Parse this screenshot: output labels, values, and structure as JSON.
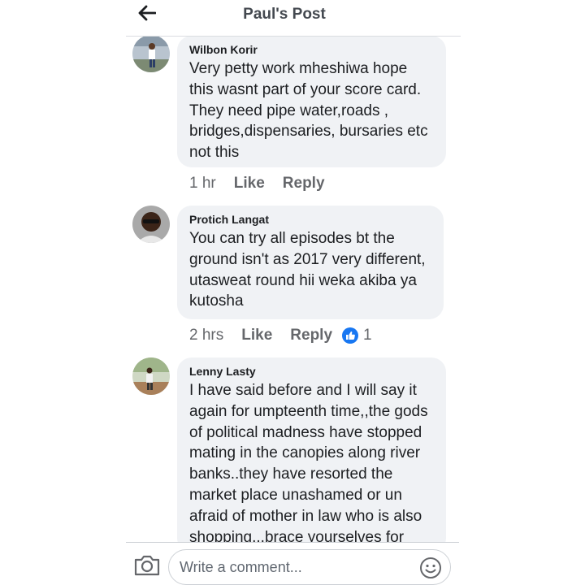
{
  "header": {
    "title": "Paul's Post",
    "back_icon": "arrow-left-icon"
  },
  "comments": [
    {
      "author": "Wilbon Korir",
      "lines": [
        "Very petty work mheshiwa hope",
        "this wasnt part of your score card.",
        "They need pipe water,roads ,",
        "bridges,dispensaries, bursaries etc",
        "not this"
      ],
      "time": "1 hr",
      "like": "Like",
      "reply": "Reply"
    },
    {
      "author": "Protich Langat",
      "lines": [
        "You can try all episodes bt the",
        "ground isn't as 2017 very different,",
        "utasweat round hii weka akiba ya",
        "kutosha"
      ],
      "time": "2 hrs",
      "like": "Like",
      "reply": "Reply",
      "reaction": {
        "icon": "thumbs-up-icon",
        "count": "1",
        "color": "#1877f2"
      }
    },
    {
      "author": "Lenny Lasty",
      "lines": [
        "I have said before and I will say it",
        "again for umpteenth time,,the gods",
        "of political madness have stopped",
        "mating in the canopies along river",
        "banks..they have resorted the",
        "market place unashamed or un",
        "afraid of mother in law who is also",
        "shopping...brace yourselves for"
      ]
    }
  ],
  "composer": {
    "placeholder": "Write a comment...",
    "camera_icon": "camera-icon",
    "emoji_icon": "smiley-icon"
  }
}
